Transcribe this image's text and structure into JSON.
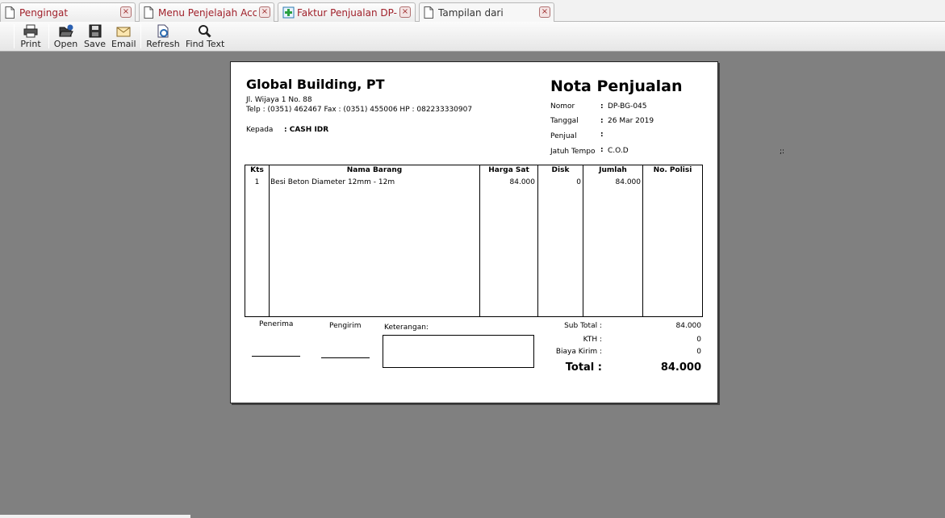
{
  "tabs": [
    {
      "label": "Pengingat",
      "icon": "document-icon"
    },
    {
      "label": "Menu Penjelajah Accur...",
      "icon": "document-icon"
    },
    {
      "label": "Faktur Penjualan DP-B...",
      "icon": "add-document-icon"
    },
    {
      "label": "Tampilan dari",
      "icon": "document-icon"
    }
  ],
  "tab_close_glyph": "×",
  "toolbar": {
    "print": "Print",
    "open": "Open",
    "save": "Save",
    "email": "Email",
    "refresh": "Refresh",
    "find_text": "Find Text"
  },
  "colors": {
    "background": "#808080",
    "tab_text": "#a0202a",
    "paper": "#ffffff"
  },
  "invoice": {
    "company": {
      "name": "Global Building, PT",
      "address": "Jl. Wijaya 1 No. 88",
      "contact": "Telp : (0351) 462467 Fax : (0351) 455006 HP : 082233330907"
    },
    "kepada_label": "Kepada",
    "kepada_value": ":  CASH IDR",
    "title": "Nota Penjualan",
    "meta": [
      {
        "label": "Nomor",
        "value": "DP-BG-045"
      },
      {
        "label": "Tanggal",
        "value": "26 Mar 2019"
      },
      {
        "label": "Penjual",
        "value": ""
      },
      {
        "label": "Jatuh Tempo",
        "value": "C.O.D"
      }
    ],
    "meta_colon": ":",
    "table": {
      "headers": {
        "qty": "Kts",
        "name": "Nama Barang",
        "price": "Harga Sat",
        "disc": "Disk",
        "amount": "Jumlah",
        "police": "No. Polisi"
      },
      "rows": [
        {
          "qty": "1",
          "name": "Besi Beton Diameter 12mm - 12m",
          "price": "84.000",
          "disc": "0",
          "amount": "84.000",
          "police": ""
        }
      ]
    },
    "signatures": {
      "receiver": "Penerima",
      "sender": "Pengirim"
    },
    "notes_label": "Keterangan:",
    "summary": {
      "subtotal_label": "Sub Total :",
      "subtotal_value": "84.000",
      "kth_label": "KTH :",
      "kth_value": "0",
      "shipping_label": "Biaya Kirim :",
      "shipping_value": "0",
      "total_label": "Total :",
      "total_value": "84.000"
    }
  },
  "stray_mark": ";:"
}
